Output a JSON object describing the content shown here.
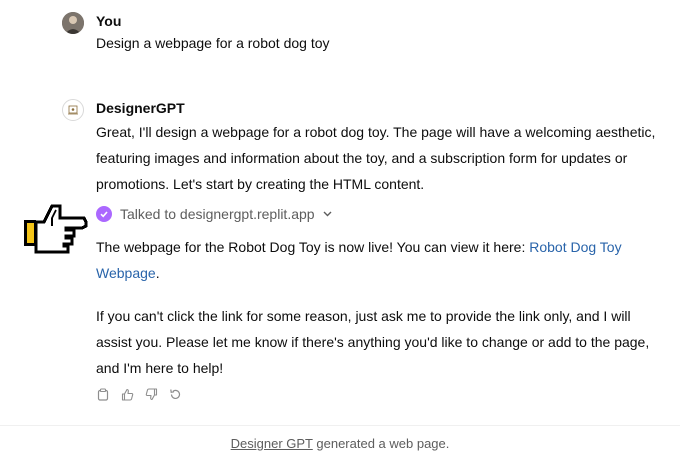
{
  "conversation": {
    "user": {
      "author": "You",
      "message": "Design a webpage for a robot dog toy"
    },
    "assistant": {
      "author": "DesignerGPT",
      "intro": "Great, I'll design a webpage for a robot dog toy. The page will have a welcoming aesthetic, featuring images and information about the toy, and a subscription form for updates or promotions. Let's start by creating the HTML content.",
      "tool_call": "Talked to designergpt.replit.app",
      "live_text": "The webpage for the Robot Dog Toy is now live! You can view it here: ",
      "link_text": "Robot Dog Toy Webpage",
      "live_suffix": ".",
      "closing": "If you can't click the link for some reason, just ask me to provide the link only, and I will assist you. Please let me know if there's anything you'd like to change or add to the page, and I'm here to help!"
    }
  },
  "actions": [
    "copy-icon",
    "thumbs-up-icon",
    "thumbs-down-icon",
    "regenerate-icon"
  ],
  "footer": {
    "gpt_name": "Designer GPT",
    "suffix": " generated a web page."
  },
  "colors": {
    "accent_check": "#ab68ff",
    "link": "#2964aa",
    "text": "#0d0d0d",
    "muted": "#5d5d5d"
  }
}
